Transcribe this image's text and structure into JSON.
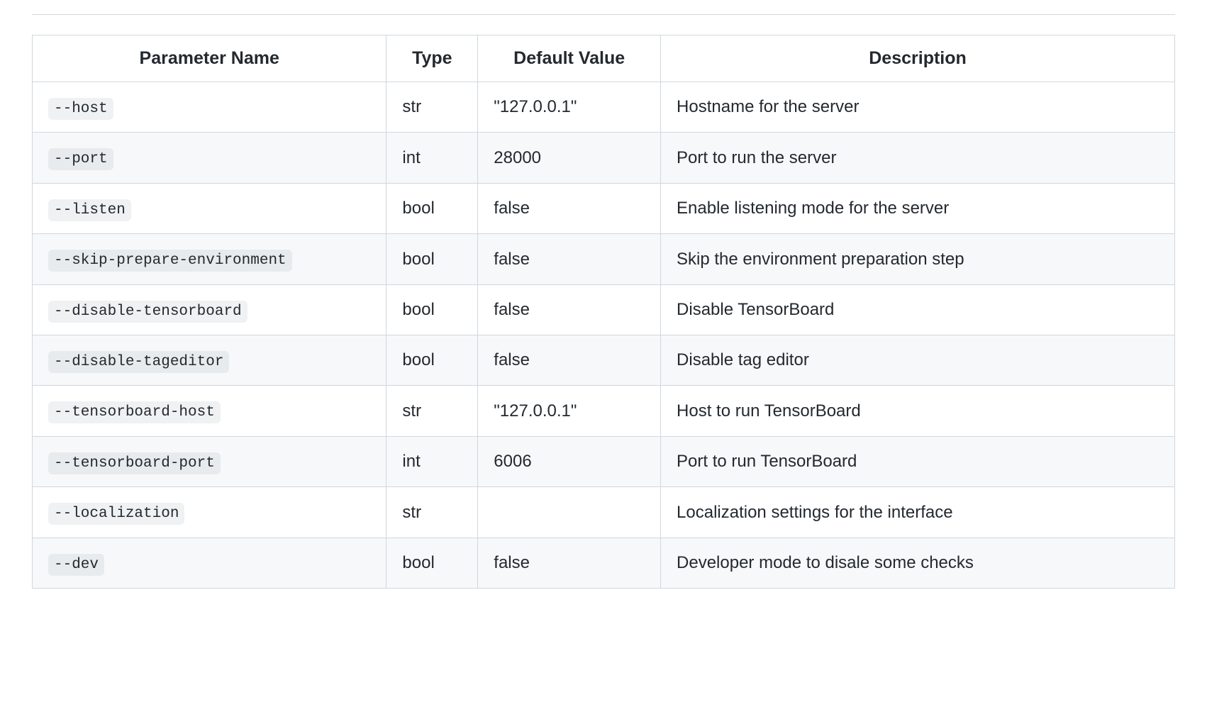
{
  "table": {
    "headers": {
      "param": "Parameter Name",
      "type": "Type",
      "default": "Default Value",
      "description": "Description"
    },
    "rows": [
      {
        "param": "--host",
        "type": "str",
        "default": "\"127.0.0.1\"",
        "description": "Hostname for the server"
      },
      {
        "param": "--port",
        "type": "int",
        "default": "28000",
        "description": "Port to run the server"
      },
      {
        "param": "--listen",
        "type": "bool",
        "default": "false",
        "description": "Enable listening mode for the server"
      },
      {
        "param": "--skip-prepare-environment",
        "type": "bool",
        "default": "false",
        "description": "Skip the environment preparation step"
      },
      {
        "param": "--disable-tensorboard",
        "type": "bool",
        "default": "false",
        "description": "Disable TensorBoard"
      },
      {
        "param": "--disable-tageditor",
        "type": "bool",
        "default": "false",
        "description": "Disable tag editor"
      },
      {
        "param": "--tensorboard-host",
        "type": "str",
        "default": "\"127.0.0.1\"",
        "description": "Host to run TensorBoard"
      },
      {
        "param": "--tensorboard-port",
        "type": "int",
        "default": "6006",
        "description": "Port to run TensorBoard"
      },
      {
        "param": "--localization",
        "type": "str",
        "default": "",
        "description": "Localization settings for the interface"
      },
      {
        "param": "--dev",
        "type": "bool",
        "default": "false",
        "description": "Developer mode to disale some checks"
      }
    ]
  }
}
